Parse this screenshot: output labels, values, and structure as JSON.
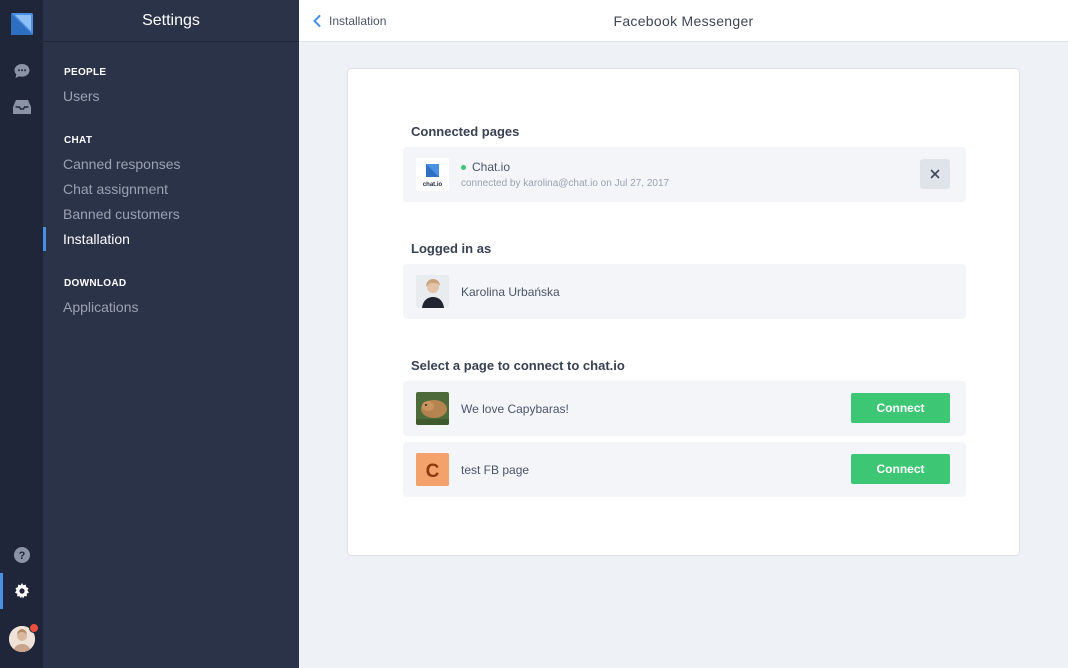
{
  "sidebar": {
    "title": "Settings",
    "sections": [
      {
        "heading": "PEOPLE",
        "items": [
          "Users"
        ]
      },
      {
        "heading": "CHAT",
        "items": [
          "Canned responses",
          "Chat assignment",
          "Banned customers",
          "Installation"
        ]
      },
      {
        "heading": "DOWNLOAD",
        "items": [
          "Applications"
        ]
      }
    ],
    "active_item": "Installation"
  },
  "rail": {
    "icons": [
      "chat-icon",
      "inbox-icon",
      "help-icon",
      "settings-icon",
      "avatar"
    ],
    "active": "settings-icon"
  },
  "topbar": {
    "back_label": "Installation",
    "title": "Facebook Messenger"
  },
  "connected": {
    "title": "Connected pages",
    "page_name": "Chat.io",
    "logo_text": "chat.io",
    "subtitle": "connected by karolina@chat.io on Jul 27, 2017"
  },
  "logged_in": {
    "title": "Logged in as",
    "user_name": "Karolina Urbańska"
  },
  "select": {
    "title": "Select a page to connect to chat.io",
    "pages": [
      {
        "name": "We love Capybaras!",
        "button": "Connect"
      },
      {
        "name": "test FB page",
        "button": "Connect",
        "initial": "C"
      }
    ]
  },
  "colors": {
    "rail_bg": "#1f2639",
    "sidebar_bg": "#2b3349",
    "accent": "#4a90e2",
    "connect_green": "#3dc774",
    "status_dot": "#3dc774",
    "notification": "#f04e3e"
  }
}
